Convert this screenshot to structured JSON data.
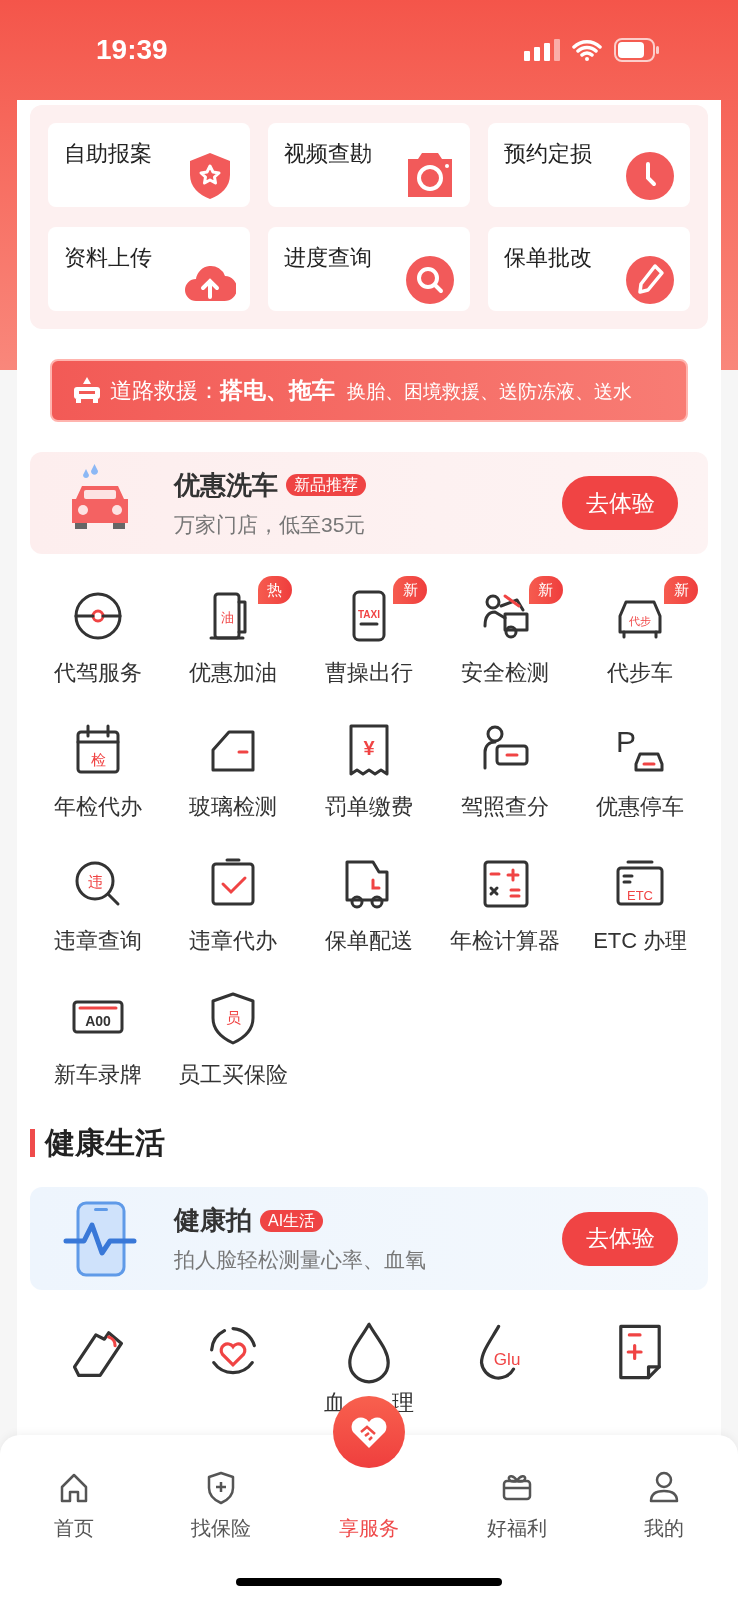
{
  "status_bar": {
    "time": "19:39"
  },
  "services": [
    {
      "label": "自助报案"
    },
    {
      "label": "视频查勘"
    },
    {
      "label": "预约定损"
    },
    {
      "label": "资料上传"
    },
    {
      "label": "进度查询"
    },
    {
      "label": "保单批改"
    }
  ],
  "rescue_banner": {
    "title": "道路救援：",
    "highlight": "搭电、拖车",
    "rest": "换胎、困境救援、送防冻液、送水"
  },
  "promo": {
    "title": "优惠洗车",
    "tag": "新品推荐",
    "subtitle": "万家门店，低至35元",
    "button": "去体验"
  },
  "grid": [
    {
      "label": "代驾服务"
    },
    {
      "label": "优惠加油",
      "icon_text": "油",
      "badge": "热"
    },
    {
      "label": "曹操出行",
      "icon_text": "TAXI",
      "badge": "新"
    },
    {
      "label": "安全检测",
      "badge": "新"
    },
    {
      "label": "代步车",
      "icon_text": "代步",
      "badge": "新"
    },
    {
      "label": "年检代办",
      "icon_text": "检"
    },
    {
      "label": "玻璃检测"
    },
    {
      "label": "罚单缴费",
      "icon_text": "¥"
    },
    {
      "label": "驾照查分"
    },
    {
      "label": "优惠停车",
      "icon_text": "P"
    },
    {
      "label": "违章查询",
      "icon_text": "违"
    },
    {
      "label": "违章代办"
    },
    {
      "label": "保单配送"
    },
    {
      "label": "年检计算器"
    },
    {
      "label": "ETC 办理",
      "icon_text": "ETC"
    },
    {
      "label": "新车录牌",
      "icon_text": "A00"
    },
    {
      "label": "员工买保险",
      "icon_text": "员"
    }
  ],
  "health_section": {
    "title": "健康生活"
  },
  "health_promo": {
    "title": "健康拍",
    "tag": "AI生活",
    "subtitle": "拍人脸轻松测量心率、血氧",
    "button": "去体验"
  },
  "health_grid": {
    "label_parts": [
      "血",
      "理"
    ],
    "glu_text": "Glu"
  },
  "tab_bar": [
    {
      "label": "首页",
      "selected": false
    },
    {
      "label": "找保险",
      "selected": false
    },
    {
      "label": "享服务",
      "selected": true
    },
    {
      "label": "好福利",
      "selected": false
    },
    {
      "label": "我的",
      "selected": false
    }
  ]
}
